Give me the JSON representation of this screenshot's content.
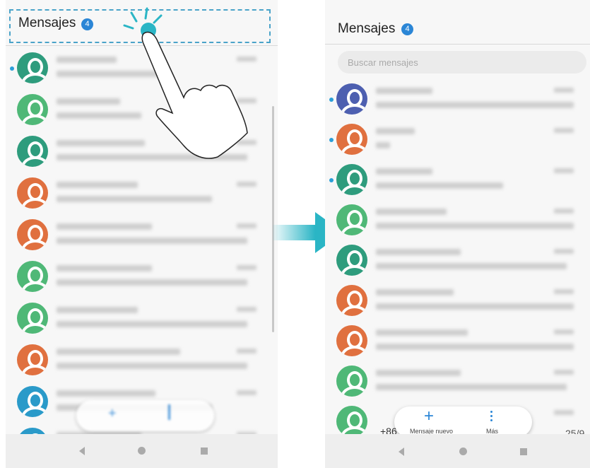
{
  "left_screen": {
    "title": "Mensajes",
    "badge": "4"
  },
  "right_screen": {
    "title": "Mensajes",
    "badge": "4",
    "search": {
      "placeholder": "Buscar mensajes"
    },
    "fab": {
      "new_label": "Mensaje nuevo",
      "more_label": "Más"
    },
    "last_row": {
      "number": "+86",
      "date": "25/9"
    }
  },
  "avatar_colors": {
    "teal": "#2e9c7d",
    "green": "#4fb877",
    "orange": "#e0703f",
    "blue": "#2a9ac9",
    "indigo": "#4d5fb0"
  },
  "accent": "#2ab5c5",
  "icons": [
    "touch-ripple-icon",
    "hand-pointer-icon",
    "arrow-right-icon",
    "plus-icon",
    "more-vertical-icon",
    "back-icon",
    "home-icon",
    "recents-icon"
  ]
}
